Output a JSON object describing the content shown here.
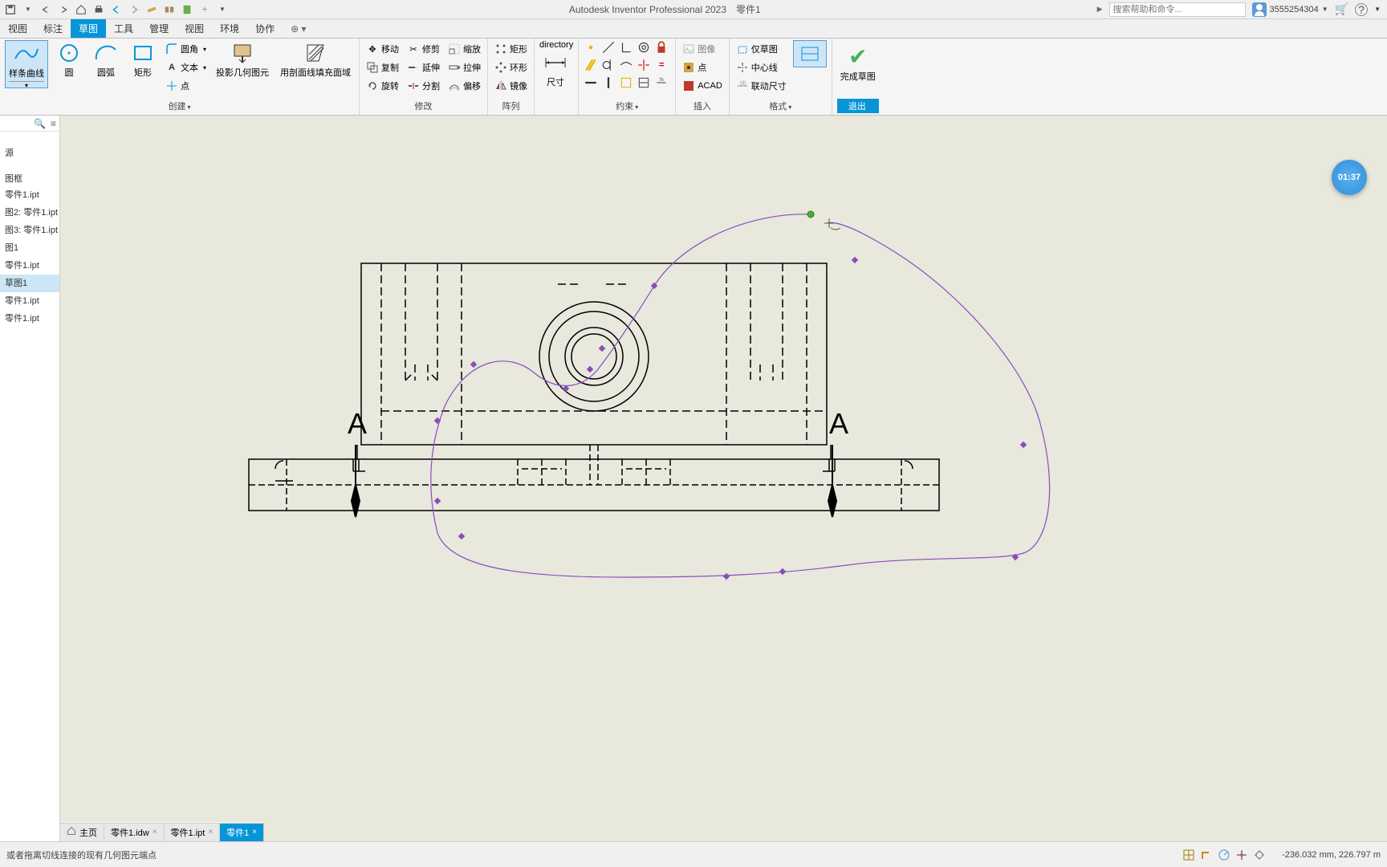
{
  "app_title": "Autodesk Inventor Professional 2023　零件1",
  "search_placeholder": "搜索帮助和命令...",
  "user_name": "3555254304",
  "timer": "01:37",
  "menu_tabs": [
    "视图",
    "标注",
    "草图",
    "工具",
    "管理",
    "视图",
    "环境",
    "协作"
  ],
  "active_menu": 2,
  "ribbon": {
    "create": {
      "label": "创建",
      "spline": "样条曲线",
      "circle": "圆",
      "arc": "圆弧",
      "rect": "矩形",
      "fillet": "圆角",
      "text": "文本",
      "point": "点",
      "project": "投影几何图元",
      "fill": "用剖面线填充面域"
    },
    "modify": {
      "label": "修改",
      "move": "移动",
      "copy": "复制",
      "rotate": "旋转",
      "trim": "修剪",
      "extend": "延伸",
      "split": "分割",
      "scale": "缩放",
      "stretch": "拉伸",
      "offset": "偏移"
    },
    "pattern": {
      "label": "阵列",
      "rect": "矩形",
      "circ": "环形",
      "mirror": "镜像"
    },
    "dimension": "尺寸",
    "constrain": "约束",
    "insert": {
      "label": "插入",
      "image": "图像",
      "point": "点",
      "acad": "ACAD"
    },
    "format": {
      "label": "格式",
      "sketch_only": "仅草图",
      "centerline": "中心线",
      "driven": "联动尺寸"
    },
    "finish": "完成草图",
    "exit": "退出"
  },
  "browser": {
    "source": "源",
    "frame": "图框",
    "items": [
      "零件1.ipt",
      "图2: 零件1.ipt",
      "图3: 零件1.ipt",
      "图1",
      "零件1.ipt",
      "草图1",
      "零件1.ipt",
      "零件1.ipt"
    ],
    "selected": 5
  },
  "section_label": "A",
  "bottom_tabs": [
    {
      "label": "主页",
      "icon": "home"
    },
    {
      "label": "零件1.idw",
      "close": true
    },
    {
      "label": "零件1.ipt",
      "close": true
    },
    {
      "label": "零件1",
      "close": true,
      "active": true
    }
  ],
  "status_text": "或者拖离切线连接的现有几何图元端点",
  "coords": "-236.032 mm, 226.797 m"
}
